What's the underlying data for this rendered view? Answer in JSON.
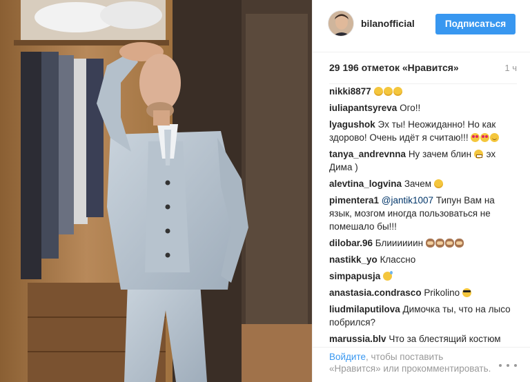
{
  "header": {
    "username": "bilanofficial",
    "follow_label": "Подписаться"
  },
  "post": {
    "likes": "29 196 отметок «Нравится»",
    "time": "1 ч"
  },
  "comments": [
    {
      "user": "nikki8877",
      "text": "",
      "emojis": [
        "unamused",
        "unamused",
        "unamused"
      ]
    },
    {
      "user": "iuliapantsyreva",
      "text": "Ого!!"
    },
    {
      "user": "lyagushok",
      "text": "Эх ты! Неожиданно! Но как здорово! Очень идёт я считаю!!!",
      "emojis": [
        "hearteyes",
        "hearteyes",
        "blush"
      ]
    },
    {
      "user": "tanya_andrevnna",
      "text": "Ну зачем блин",
      "emoji_mid": "grimace",
      "text_after": "эх Дима )"
    },
    {
      "user": "alevtina_logvina",
      "text": "Зачем",
      "emojis": [
        "unamused"
      ]
    },
    {
      "user": "pimentera1",
      "mention": "@jantik1007",
      "text": "Типун Вам на язык, мозгом иногда пользоваться не помешало бы!!!"
    },
    {
      "user": "dilobar.96",
      "text": "Блиииииин",
      "emojis": [
        "monkey",
        "monkey",
        "monkey",
        "monkey"
      ]
    },
    {
      "user": "nastikk_yo",
      "text": "Классно"
    },
    {
      "user": "simpapusja",
      "text": "",
      "emojis": [
        "sweat"
      ]
    },
    {
      "user": "anastasia.condrasco",
      "text": "Prikolino",
      "emojis": [
        "sunglasses"
      ]
    },
    {
      "user": "liudmilaputilova",
      "text": "Димочка ты, что на лысо побрился?"
    },
    {
      "user": "marussia.blv",
      "text": "Что за блестящий костюм"
    }
  ],
  "footer": {
    "login_label": "Войдите",
    "text": ", чтобы поставить «Нравится» или прокомментировать."
  },
  "colors": {
    "accent": "#3897f0",
    "text": "#262626",
    "muted": "#999999",
    "mention": "#003569"
  },
  "icons": {
    "more": "more-options-icon"
  }
}
